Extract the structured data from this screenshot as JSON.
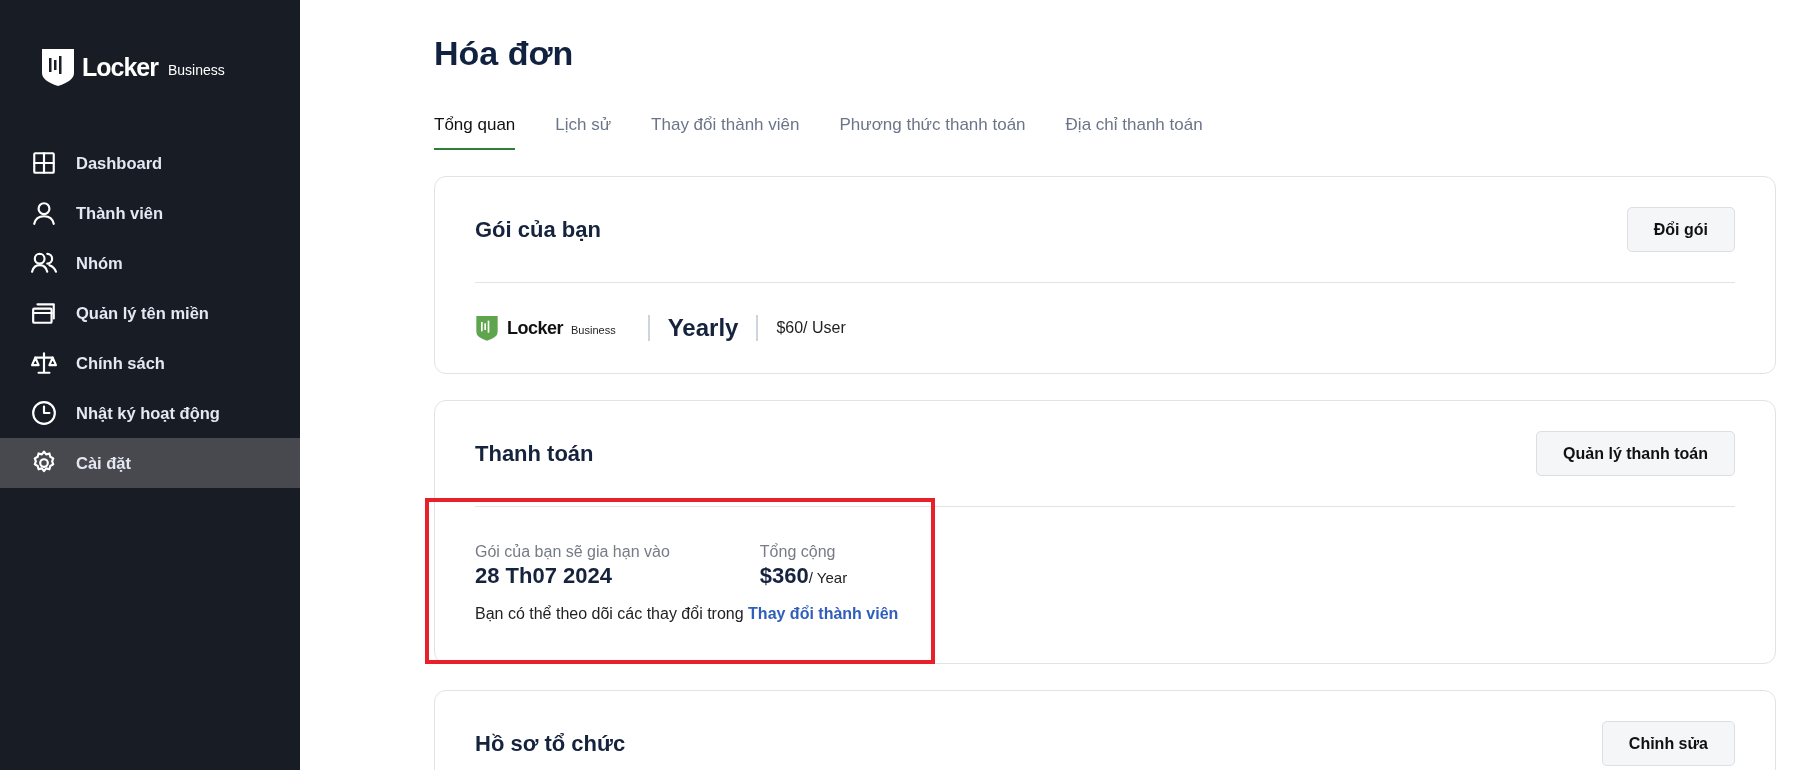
{
  "sidebar": {
    "logo": {
      "name": "Locker",
      "edition": "Business"
    },
    "items": [
      {
        "label": "Dashboard",
        "selected": false
      },
      {
        "label": "Thành viên",
        "selected": false
      },
      {
        "label": "Nhóm",
        "selected": false
      },
      {
        "label": "Quản lý tên miền",
        "selected": false
      },
      {
        "label": "Chính sách",
        "selected": false
      },
      {
        "label": "Nhật ký hoạt động",
        "selected": false
      },
      {
        "label": "Cài đặt",
        "selected": true
      }
    ]
  },
  "page": {
    "title": "Hóa đơn"
  },
  "tabs": [
    {
      "label": "Tổng quan",
      "selected": true
    },
    {
      "label": "Lịch sử",
      "selected": false
    },
    {
      "label": "Thay đổi thành viên",
      "selected": false
    },
    {
      "label": "Phương thức thanh toán",
      "selected": false
    },
    {
      "label": "Địa chỉ thanh toán",
      "selected": false
    }
  ],
  "plan_card": {
    "title": "Gói của bạn",
    "button": "Đổi gói",
    "logo": {
      "name": "Locker",
      "edition": "Business"
    },
    "period": "Yearly",
    "price": "$60/ User"
  },
  "payment_card": {
    "title": "Thanh toán",
    "button": "Quản lý thanh toán",
    "highlighted": true,
    "renew_label": "Gói của bạn sẽ gia hạn vào",
    "renew_date": "28 Th07 2024",
    "total_label": "Tổng cộng",
    "total": "$360",
    "total_unit": "/ Year",
    "note": "Bạn có thể theo dõi các thay đổi trong",
    "note_link": "Thay đổi thành viên"
  },
  "org_card": {
    "title": "Hồ sơ tổ chức",
    "button": "Chỉnh sửa"
  }
}
